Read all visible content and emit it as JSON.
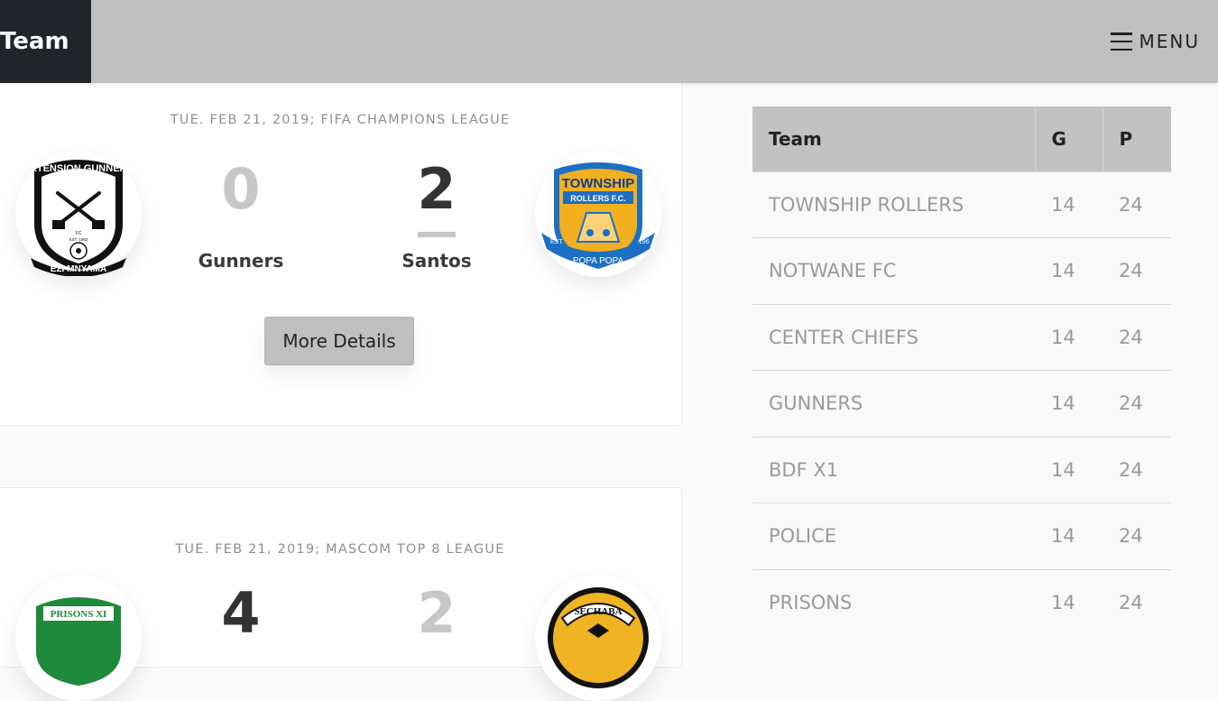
{
  "header": {
    "brand": "Team",
    "menu_label": "MENU"
  },
  "matches": [
    {
      "date_league": "TUE. FEB 21, 2019; FIFA CHAMPIONS LEAGUE",
      "home": {
        "name": "Gunners",
        "score": "0",
        "logo_top": "EXTENSION GUNNERS",
        "logo_mid": "FC",
        "logo_est": "EST. 1962",
        "logo_bottom": "EZI MNYAMA"
      },
      "away": {
        "name": "Santos",
        "score": "2",
        "logo_top": "TOWNSHIP",
        "logo_mid": "ROLLERS F.C.",
        "logo_bottom": "POPA POPA",
        "logo_left": "EST.",
        "logo_right": "196"
      },
      "button": "More Details"
    },
    {
      "date_league": "TUE. FEB 21, 2019; MASCOM TOP 8 LEAGUE",
      "home": {
        "score": "4",
        "logo_top": "PRISONS XI"
      },
      "away": {
        "score": "2",
        "logo_top": "SECHABA"
      }
    }
  ],
  "standings": {
    "headers": [
      "Team",
      "G",
      "P"
    ],
    "rows": [
      {
        "team": "TOWNSHIP ROLLERS",
        "g": "14",
        "p": "24"
      },
      {
        "team": "NOTWANE FC",
        "g": "14",
        "p": "24"
      },
      {
        "team": "CENTER CHIEFS",
        "g": "14",
        "p": "24"
      },
      {
        "team": "GUNNERS",
        "g": "14",
        "p": "24"
      },
      {
        "team": "BDF X1",
        "g": "14",
        "p": "24"
      },
      {
        "team": "POLICE",
        "g": "14",
        "p": "24"
      },
      {
        "team": "PRISONS",
        "g": "14",
        "p": "24"
      }
    ]
  },
  "colors": {
    "header_bg": "#bfbfbf",
    "brand_bg": "#212529",
    "township_blue": "#1d6fc4",
    "township_gold": "#f2b01e",
    "prisons_green": "#1f8a3b",
    "sechaba_gold": "#f0b323"
  }
}
